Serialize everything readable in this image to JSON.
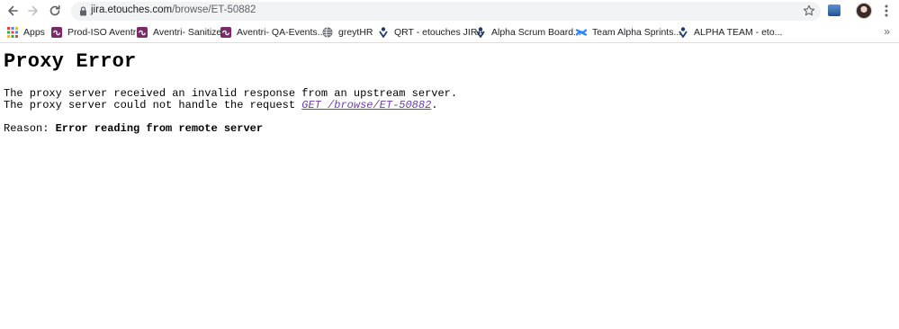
{
  "browser": {
    "url_host": "jira.etouches.com",
    "url_path": "/browse/ET-50882"
  },
  "bookmarks": [
    {
      "label": "Apps",
      "icon": "apps-grid-icon"
    },
    {
      "label": "Prod-ISO Aventri",
      "icon": "aventri-icon"
    },
    {
      "label": "Aventri- Sanitize",
      "icon": "aventri-icon"
    },
    {
      "label": "Aventri- QA-Events...",
      "icon": "aventri-icon"
    },
    {
      "label": "greytHR",
      "icon": "globe-icon"
    },
    {
      "label": "QRT - etouches JIRA",
      "icon": "jira-icon"
    },
    {
      "label": "Alpha Scrum Board...",
      "icon": "jira-icon"
    },
    {
      "label": "Team Alpha Sprints...",
      "icon": "confluence-icon"
    },
    {
      "label": "ALPHA TEAM - eto...",
      "icon": "jira-icon"
    }
  ],
  "page": {
    "heading": "Proxy Error",
    "line1": "The proxy server received an invalid response from an upstream server.",
    "line2_prefix": "The proxy server could not handle the request ",
    "line2_link": "GET /browse/ET-50882",
    "line2_suffix": ".",
    "reason_label": "Reason: ",
    "reason_text": "Error reading from remote server"
  }
}
